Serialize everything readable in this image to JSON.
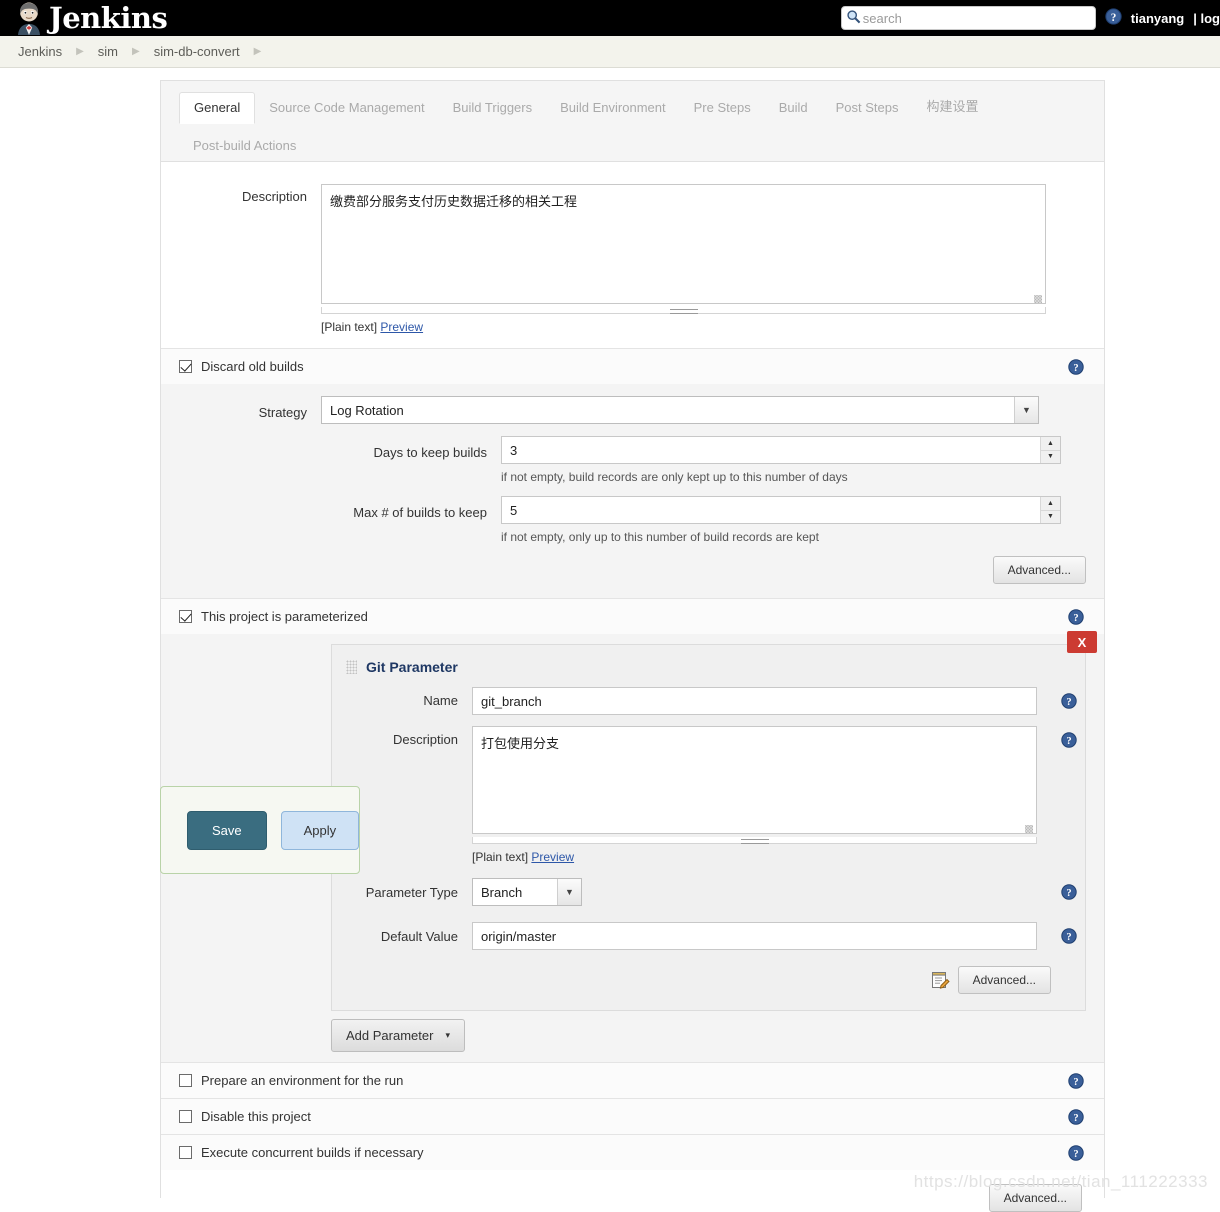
{
  "header": {
    "brand": "Jenkins",
    "logo_icon": "jenkins-butler-logo",
    "search": {
      "placeholder": "search",
      "value": "",
      "icon": "search-icon"
    },
    "help_icon": "help-circle-icon",
    "user": "tianyang",
    "logout": "| log"
  },
  "breadcrumb": {
    "items": [
      "Jenkins",
      "sim",
      "sim-db-convert"
    ],
    "separator_icon": "chevron-right-icon"
  },
  "tabs": {
    "row1": [
      "General",
      "Source Code Management",
      "Build Triggers",
      "Build Environment",
      "Pre Steps",
      "Build",
      "Post Steps",
      "构建设置"
    ],
    "row2": [
      "Post-build Actions"
    ],
    "active": "General"
  },
  "description": {
    "label": "Description",
    "value": "缴费部分服务支付历史数据迁移的相关工程",
    "plain_text_label": "[Plain text]",
    "preview_link": "Preview"
  },
  "discard_old_builds": {
    "checkbox_label": "Discard old builds",
    "checked": true,
    "strategy_label": "Strategy",
    "strategy_value": "Log Rotation",
    "strategy_options": [
      "Log Rotation"
    ],
    "days_label": "Days to keep builds",
    "days_value": "3",
    "days_hint": "if not empty, build records are only kept up to this number of days",
    "max_label": "Max # of builds to keep",
    "max_value": "5",
    "max_hint": "if not empty, only up to this number of build records are kept",
    "advanced_button": "Advanced..."
  },
  "parameterized": {
    "checkbox_label": "This project is parameterized",
    "checked": true,
    "param": {
      "title": "Git Parameter",
      "delete_label": "X",
      "drag_icon": "drag-handle-icon",
      "name_label": "Name",
      "name_value": "git_branch",
      "description_label": "Description",
      "description_value": "打包使用分支",
      "plain_text_label": "[Plain text]",
      "preview_link": "Preview",
      "type_label": "Parameter Type",
      "type_value": "Branch",
      "type_options": [
        "Branch"
      ],
      "default_label": "Default Value",
      "default_value": "origin/master",
      "settings_icon": "notepad-edit-icon",
      "advanced_button": "Advanced..."
    },
    "add_parameter_button": "Add Parameter",
    "add_parameter_caret": "▾"
  },
  "options": [
    {
      "label": "Prepare an environment for the run",
      "checked": false
    },
    {
      "label": "Disable this project",
      "checked": false
    },
    {
      "label": "Execute concurrent builds if necessary",
      "checked": false
    }
  ],
  "bottom_advanced_button": "Advanced...",
  "save_panel": {
    "save_label": "Save",
    "apply_label": "Apply"
  },
  "watermark": "https://blog.csdn.net/tian_111222333",
  "colors": {
    "topbar_bg": "#000000",
    "breadcrumb_bg": "#f3f3ec",
    "save_button": "#3a6d80",
    "apply_button": "#cfe2f5",
    "delete_button": "#cc3b32",
    "help_icon": "#3a5f99",
    "link": "#2d57a8",
    "param_title": "#1f3864"
  }
}
